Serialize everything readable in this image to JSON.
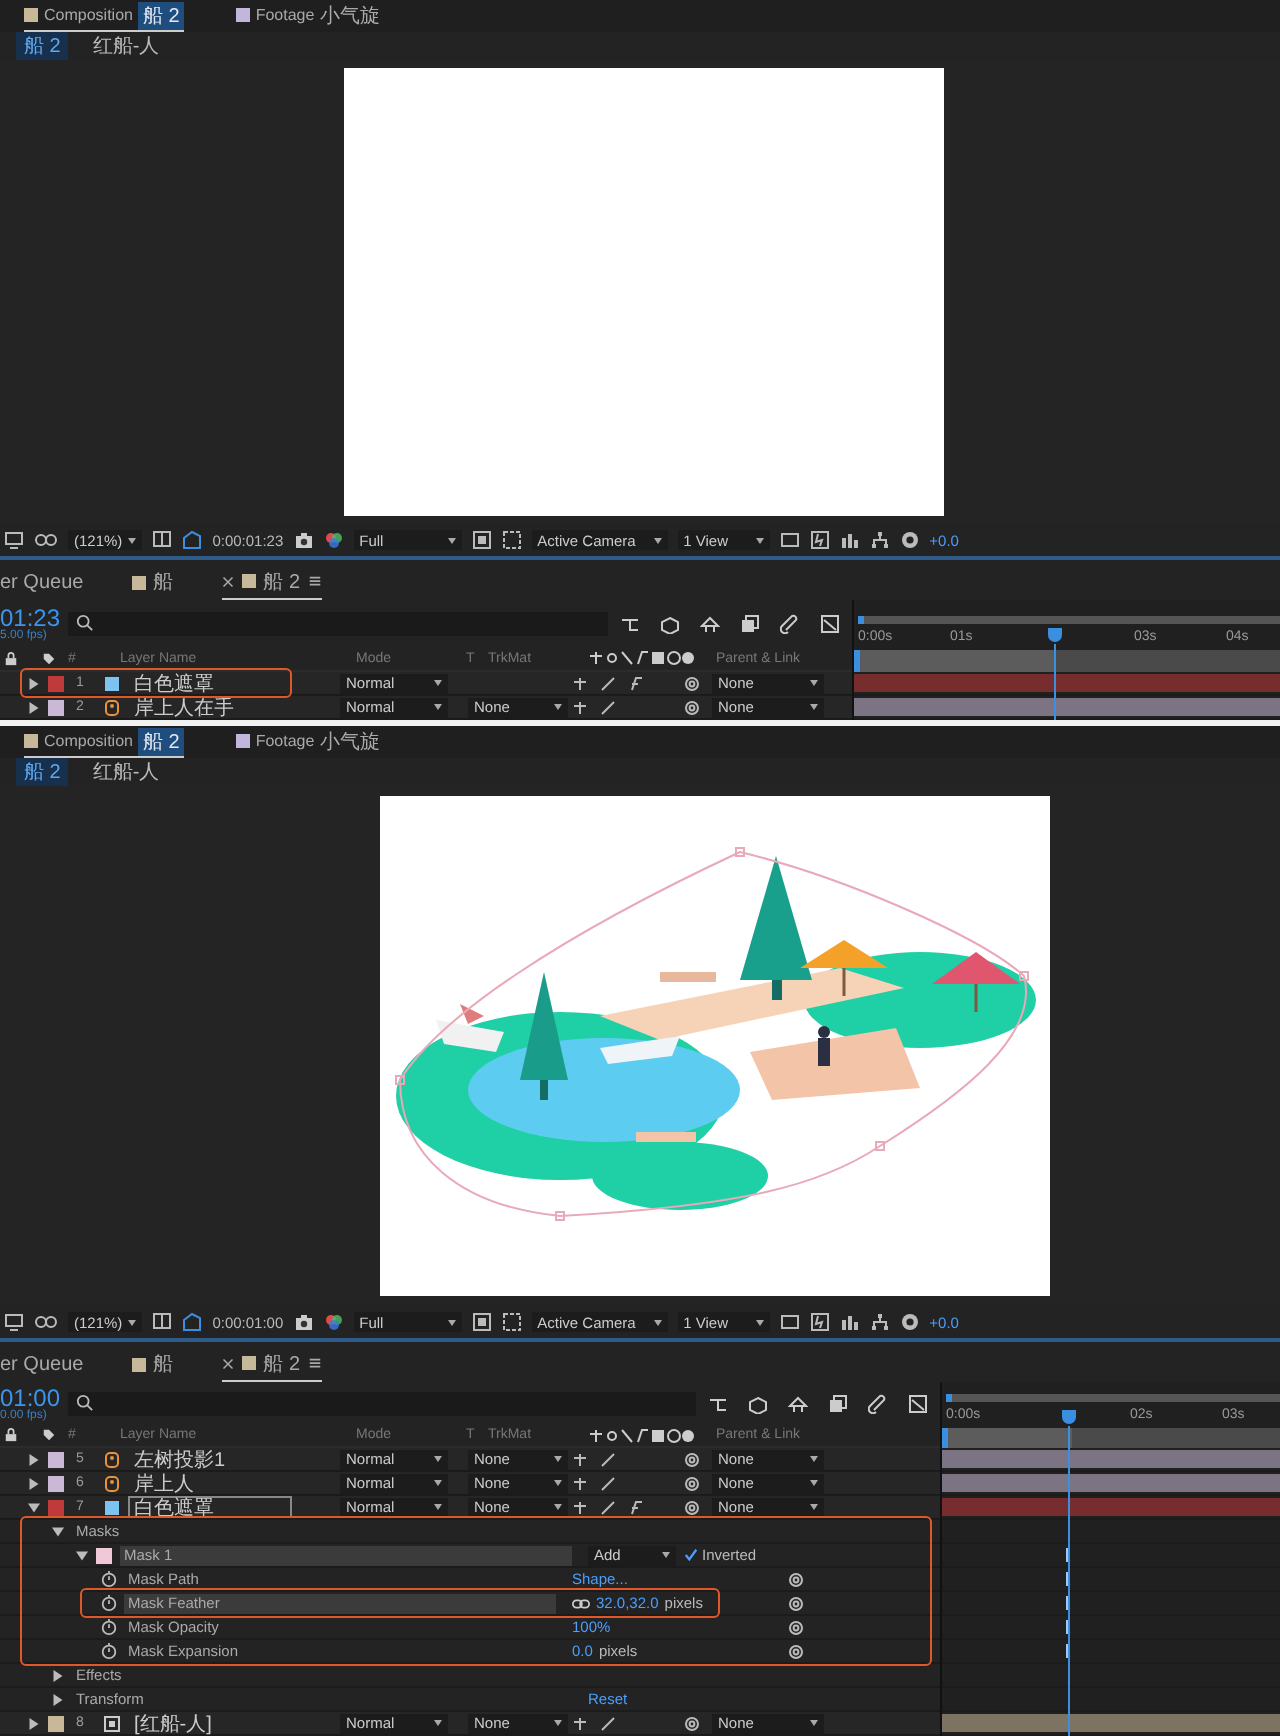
{
  "panels": [
    {
      "tabs": [
        {
          "prefix": "Composition",
          "name": "船 2",
          "selected": true
        },
        {
          "prefix": "Footage",
          "name": "小气旋",
          "selected": false
        }
      ],
      "breadcrumb": [
        {
          "label": "船 2",
          "selected": true
        },
        {
          "label": "红船-人",
          "selected": false
        }
      ],
      "viewer": {
        "kind": "blank"
      },
      "toolbar": {
        "zoom": "(121%)",
        "time": "0:00:01:23",
        "resolution": "Full",
        "camera": "Active Camera",
        "views": "1 View",
        "exposure": "+0.0"
      },
      "timeline_tabs": [
        {
          "label": "er Queue",
          "swatch": false,
          "selected": false
        },
        {
          "label": "船",
          "swatch": true,
          "selected": false
        },
        {
          "label": "船 2",
          "swatch": true,
          "selected": true
        }
      ],
      "timecode": "01:23",
      "fps": "5.00 fps)",
      "columns": {
        "number": "#",
        "name": "Layer Name",
        "mode": "Mode",
        "t": "T",
        "trkmat": "TrkMat",
        "parent": "Parent & Link"
      },
      "ticks": [
        {
          "label": "0:00s",
          "gap": false
        },
        {
          "label": "01s",
          "gap": false
        },
        {
          "label": "03s",
          "gap": true
        },
        {
          "label": "04s",
          "gap": false
        }
      ],
      "playhead": {
        "level": 0.43
      },
      "layers": [
        {
          "kind": "solid",
          "number": "1",
          "color": "#c0393b",
          "name": "白色遮罩",
          "mode": "Normal",
          "parent": "None",
          "fx": true,
          "selected": false,
          "callout": true,
          "expanded": false
        },
        {
          "kind": "shape",
          "number": "2",
          "color": "#c9b9d6",
          "name": "岸上人在手",
          "mode": "Normal",
          "trkmat": "None",
          "parent": "None",
          "fx": false,
          "selected": false,
          "callout": false,
          "expanded": false
        }
      ]
    },
    {
      "tabs": [
        {
          "prefix": "Composition",
          "name": "船 2",
          "selected": true
        },
        {
          "prefix": "Footage",
          "name": "小气旋",
          "selected": false
        }
      ],
      "breadcrumb": [
        {
          "label": "船 2",
          "selected": true
        },
        {
          "label": "红船-人",
          "selected": false
        }
      ],
      "viewer": {
        "kind": "scene"
      },
      "toolbar": {
        "zoom": "(121%)",
        "time": "0:00:01:00",
        "resolution": "Full",
        "camera": "Active Camera",
        "views": "1 View",
        "exposure": "+0.0"
      },
      "timeline_tabs": [
        {
          "label": "er Queue",
          "swatch": false,
          "selected": false
        },
        {
          "label": "船",
          "swatch": true,
          "selected": false
        },
        {
          "label": "船 2",
          "swatch": true,
          "selected": true
        }
      ],
      "timecode": "01:00",
      "fps": "0.00 fps)",
      "columns": {
        "number": "#",
        "name": "Layer Name",
        "mode": "Mode",
        "t": "T",
        "trkmat": "TrkMat",
        "parent": "Parent & Link"
      },
      "ticks": [
        {
          "label": "0:00s",
          "gap": false
        },
        {
          "label": "02s",
          "gap": true
        },
        {
          "label": "03s",
          "gap": false
        }
      ],
      "playhead": {
        "level": 0.34
      },
      "layers": [
        {
          "kind": "shape",
          "number": "5",
          "color": "#c9b9d6",
          "name": "左树投影1",
          "mode": "Normal",
          "trkmat": "None",
          "parent": "None",
          "fx": false,
          "selected": false,
          "callout": false,
          "expanded": false
        },
        {
          "kind": "shape",
          "number": "6",
          "color": "#c9b9d6",
          "name": "岸上人",
          "mode": "Normal",
          "trkmat": "None",
          "parent": "None",
          "fx": false,
          "selected": false,
          "callout": false,
          "expanded": false
        },
        {
          "kind": "solid",
          "number": "7",
          "color": "#c0393b",
          "name": "白色遮罩",
          "mode": "Normal",
          "trkmat": "None",
          "parent": "None",
          "fx": true,
          "selected": true,
          "callout": false,
          "expanded": true,
          "children": [
            {
              "kind": "group",
              "name": "Masks",
              "expanded": true,
              "callout": true,
              "children": [
                {
                  "kind": "mask",
                  "name": "Mask 1",
                  "color": "#f0c8d8",
                  "expanded": true,
                  "selected": true,
                  "mode": "Add",
                  "inverted": {
                    "label": "Inverted",
                    "checked": true
                  },
                  "keyframe": true,
                  "children": [
                    {
                      "kind": "property",
                      "name": "Mask Path",
                      "value": "Shape...",
                      "selected": false,
                      "keyframe": true
                    },
                    {
                      "kind": "property",
                      "name": "Mask Feather",
                      "value": "32.0,32.0",
                      "unit": "pixels",
                      "linked": true,
                      "selected": true,
                      "callout": true,
                      "keyframe": true
                    },
                    {
                      "kind": "property",
                      "name": "Mask Opacity",
                      "value": "100%",
                      "selected": false,
                      "keyframe": true
                    },
                    {
                      "kind": "property",
                      "name": "Mask Expansion",
                      "value": "0.0",
                      "unit": "pixels",
                      "selected": false,
                      "keyframe": true
                    }
                  ]
                }
              ]
            },
            {
              "kind": "group",
              "name": "Effects",
              "expanded": false
            },
            {
              "kind": "group",
              "name": "Transform",
              "expanded": false,
              "value": "Reset"
            }
          ]
        },
        {
          "kind": "precomp",
          "number": "8",
          "color": "#c8b89a",
          "name": "[红船-人]",
          "mode": "Normal",
          "trkmat": "None",
          "parent": "None",
          "fx": false,
          "selected": false,
          "callout": false,
          "expanded": false
        }
      ]
    }
  ]
}
